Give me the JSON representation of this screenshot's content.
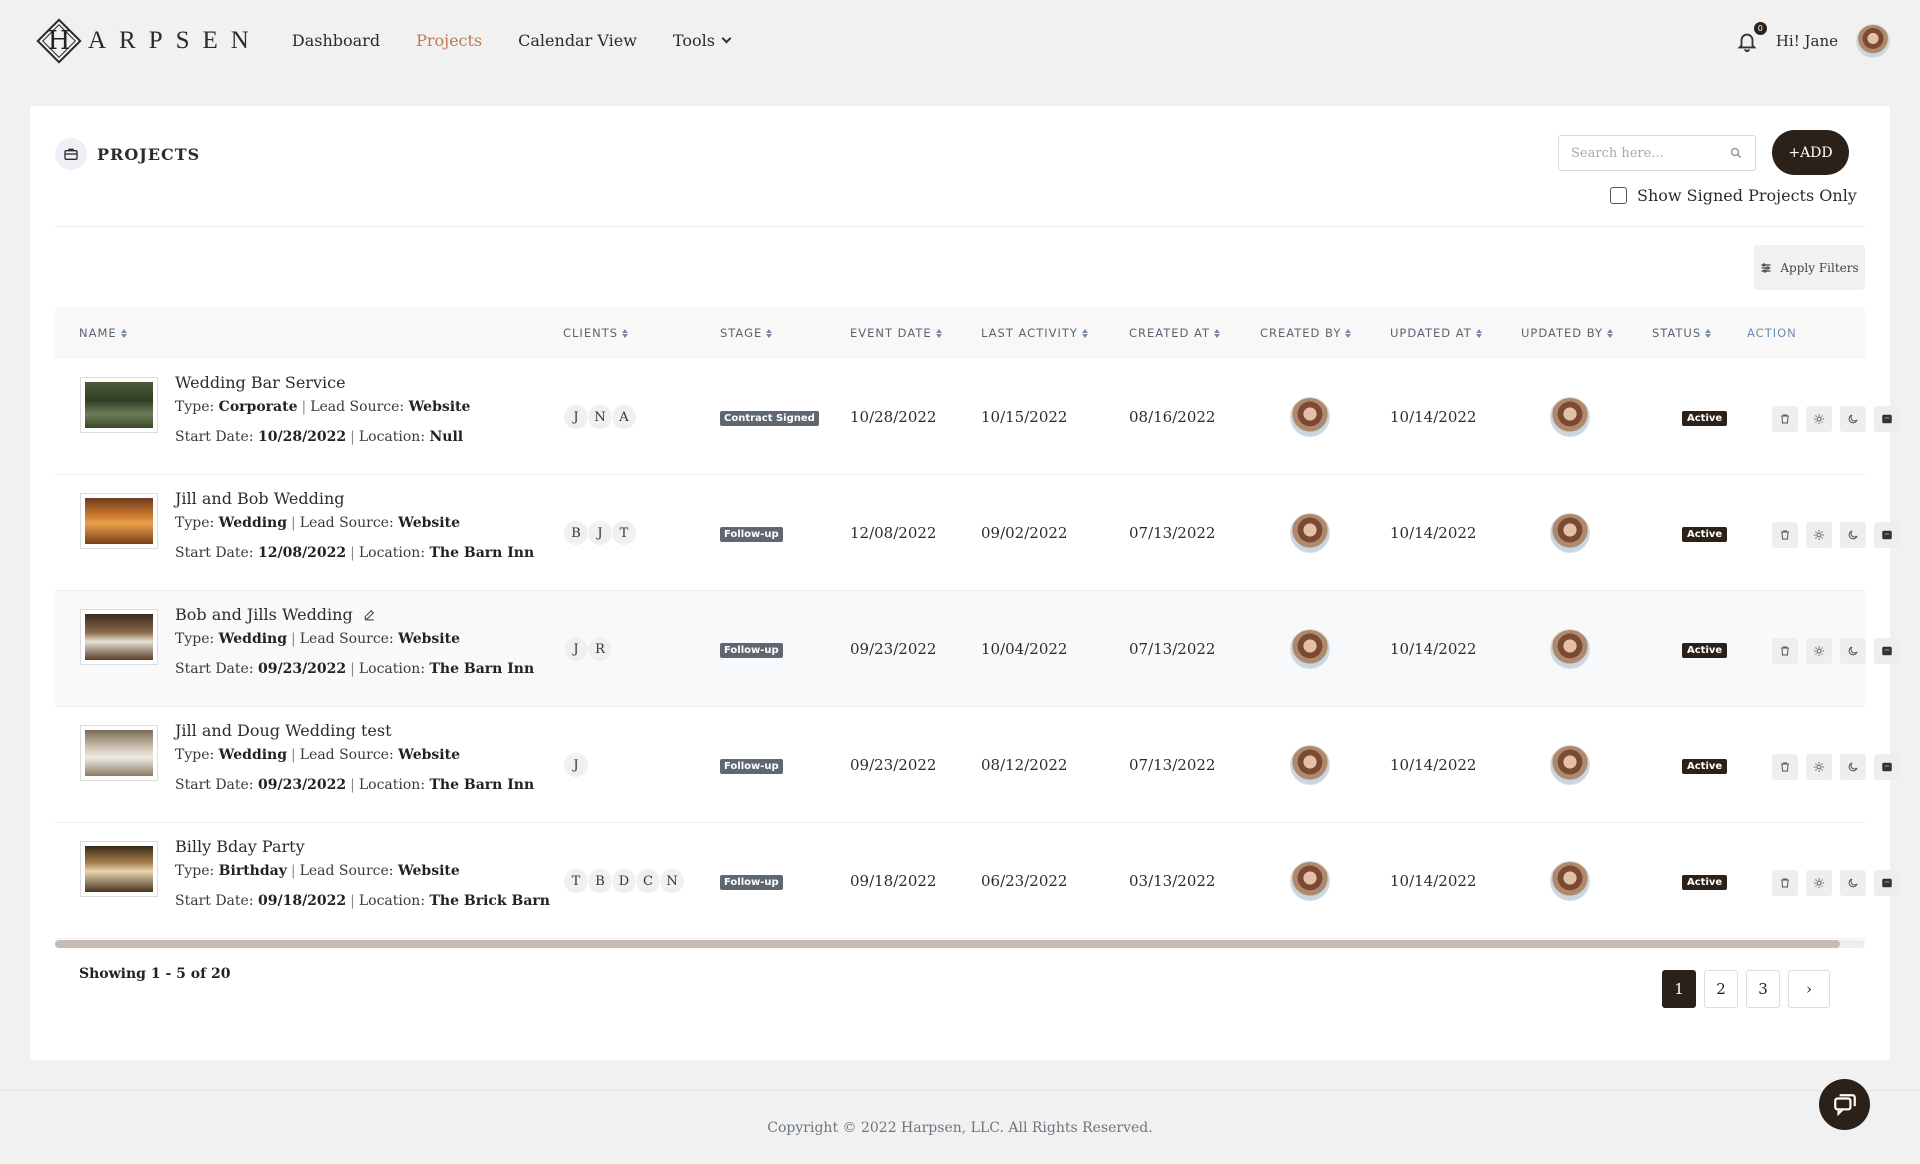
{
  "brand": {
    "logo_letter": "H",
    "wordmark": "ARPSEN"
  },
  "nav": {
    "items": [
      {
        "label": "Dashboard"
      },
      {
        "label": "Projects"
      },
      {
        "label": "Calendar View"
      },
      {
        "label": "Tools"
      }
    ],
    "active": "Projects"
  },
  "user": {
    "notifications": "0",
    "greeting": "Hi! Jane"
  },
  "page": {
    "title": "PROJECTS",
    "search_placeholder": "Search here...",
    "add_label": "+ADD",
    "signed_only_label": "Show Signed Projects Only",
    "apply_filters_label": "Apply Filters"
  },
  "table": {
    "columns": [
      "NAME",
      "CLIENTS",
      "STAGE",
      "EVENT DATE",
      "LAST ACTIVITY",
      "CREATED AT",
      "CREATED BY",
      "UPDATED AT",
      "UPDATED BY",
      "STATUS",
      "ACTION"
    ],
    "type_label": "Type:",
    "lead_label": "Lead Source:",
    "start_label": "Start Date:",
    "location_label": "Location:",
    "rows": [
      {
        "name": "Wedding Bar Service",
        "type": "Corporate",
        "lead_source": "Website",
        "start_date": "10/28/2022",
        "location": "Null",
        "clients": [
          "J",
          "N",
          "A"
        ],
        "stage": "Contract Signed",
        "event_date": "10/28/2022",
        "last_activity": "10/15/2022",
        "created_at": "08/16/2022",
        "updated_at": "10/14/2022",
        "status": "Active"
      },
      {
        "name": "Jill and Bob Wedding",
        "type": "Wedding",
        "lead_source": "Website",
        "start_date": "12/08/2022",
        "location": "The Barn Inn",
        "clients": [
          "B",
          "J",
          "T"
        ],
        "stage": "Follow-up",
        "event_date": "12/08/2022",
        "last_activity": "09/02/2022",
        "created_at": "07/13/2022",
        "updated_at": "10/14/2022",
        "status": "Active"
      },
      {
        "name": "Bob and Jills Wedding",
        "type": "Wedding",
        "lead_source": "Website",
        "start_date": "09/23/2022",
        "location": "The Barn Inn",
        "clients": [
          "J",
          "R"
        ],
        "stage": "Follow-up",
        "event_date": "09/23/2022",
        "last_activity": "10/04/2022",
        "created_at": "07/13/2022",
        "updated_at": "10/14/2022",
        "status": "Active"
      },
      {
        "name": "Jill and Doug Wedding test",
        "type": "Wedding",
        "lead_source": "Website",
        "start_date": "09/23/2022",
        "location": "The Barn Inn",
        "clients": [
          "J"
        ],
        "stage": "Follow-up",
        "event_date": "09/23/2022",
        "last_activity": "08/12/2022",
        "created_at": "07/13/2022",
        "updated_at": "10/14/2022",
        "status": "Active"
      },
      {
        "name": "Billy Bday Party",
        "type": "Birthday",
        "lead_source": "Website",
        "start_date": "09/18/2022",
        "location": "The Brick Barn",
        "clients": [
          "T",
          "B",
          "D",
          "C",
          "N"
        ],
        "stage": "Follow-up",
        "event_date": "09/18/2022",
        "last_activity": "06/23/2022",
        "created_at": "03/13/2022",
        "updated_at": "10/14/2022",
        "status": "Active"
      }
    ],
    "row_actions": [
      "trash-icon",
      "sun-icon",
      "moon-icon",
      "archive-icon"
    ]
  },
  "pagination": {
    "showing": "Showing 1 - 5 of 20",
    "pages": [
      "1",
      "2",
      "3"
    ],
    "current": "1",
    "next": "›"
  },
  "footer": {
    "copyright": "Copyright © 2022 Harpsen, LLC. All Rights Reserved."
  },
  "colors": {
    "brand_dark": "#2b2118",
    "accent": "#c3794e",
    "stage_badge": "#5f6770"
  }
}
